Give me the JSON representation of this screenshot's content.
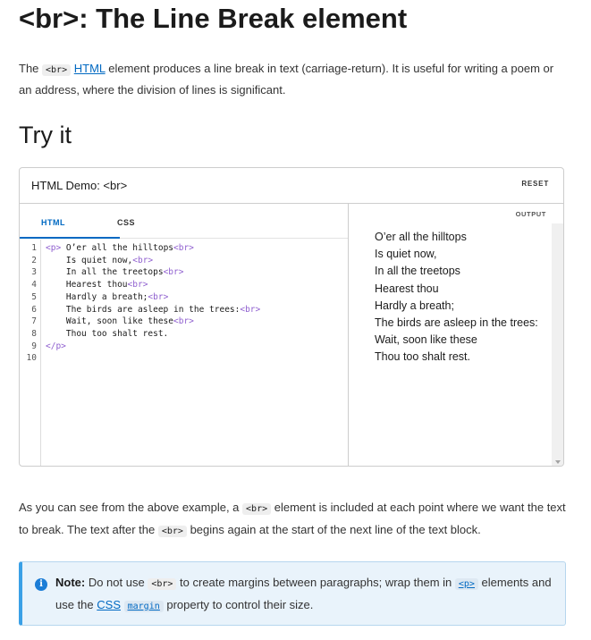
{
  "page": {
    "title": "<br>: The Line Break element"
  },
  "intro": {
    "pre": "The ",
    "code": "<br>",
    "link": "HTML",
    "post": " element produces a line break in text (carriage-return). It is useful for writing a poem or an address, where the division of lines is significant."
  },
  "tryit": {
    "heading": "Try it"
  },
  "demo": {
    "title": "HTML Demo: <br>",
    "reset_label": "RESET",
    "tabs": [
      {
        "label": "HTML"
      },
      {
        "label": "CSS"
      }
    ],
    "output_label": "OUTPUT",
    "code_lines": [
      {
        "num": "1",
        "indent": "",
        "text": "O’er all the hilltops",
        "open": "<p>",
        "close": "<br>"
      },
      {
        "num": "2",
        "indent": "    ",
        "text": "Is quiet now,",
        "open": "",
        "close": "<br>"
      },
      {
        "num": "3",
        "indent": "    ",
        "text": "In all the treetops",
        "open": "",
        "close": "<br>"
      },
      {
        "num": "4",
        "indent": "    ",
        "text": "Hearest thou",
        "open": "",
        "close": "<br>"
      },
      {
        "num": "5",
        "indent": "    ",
        "text": "Hardly a breath;",
        "open": "",
        "close": "<br>"
      },
      {
        "num": "6",
        "indent": "    ",
        "text": "The birds are asleep in the trees:",
        "open": "",
        "close": "<br>"
      },
      {
        "num": "7",
        "indent": "    ",
        "text": "Wait, soon like these",
        "open": "",
        "close": "<br>"
      },
      {
        "num": "8",
        "indent": "    ",
        "text": "Thou too shalt rest.",
        "open": "",
        "close": ""
      },
      {
        "num": "9",
        "indent": "",
        "text": "",
        "open": "</p>",
        "close": ""
      },
      {
        "num": "10",
        "indent": "",
        "text": "",
        "open": "",
        "close": ""
      }
    ],
    "output_lines": [
      "O’er all the hilltops",
      "Is quiet now,",
      "In all the treetops",
      "Hearest thou",
      "Hardly a breath;",
      "The birds are asleep in the trees:",
      "Wait, soon like these",
      "Thou too shalt rest."
    ]
  },
  "para2": {
    "t1": "As you can see from the above example, a ",
    "code1": "<br>",
    "t2": " element is included at each point where we want the text to break. The text after the ",
    "code2": "<br>",
    "t3": " begins again at the start of the next line of the text block."
  },
  "note": {
    "icon": "info-icon",
    "label": "Note:",
    "t1": " Do not use ",
    "code1": "<br>",
    "t2": " to create margins between paragraphs; wrap them in ",
    "code2": "<p>",
    "t3": " elements and use the ",
    "link": "CSS",
    "code3": "margin",
    "t4": " property to control their size."
  },
  "colors": {
    "link": "#0069c2",
    "tag": "#8f5fcf",
    "note_accent": "#3aa0e6"
  }
}
